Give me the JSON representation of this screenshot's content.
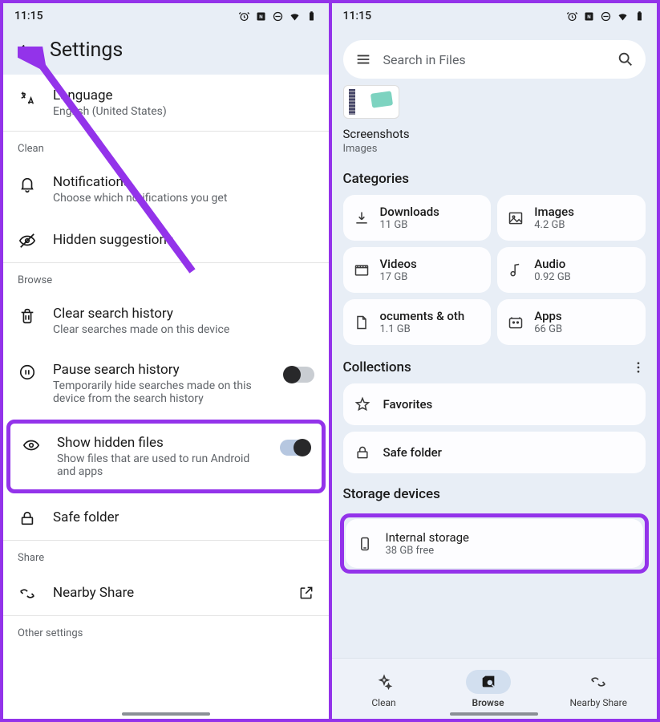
{
  "status": {
    "time": "11:15"
  },
  "left": {
    "header_title": "Settings",
    "language": {
      "title": "Language",
      "sub": "English (United States)"
    },
    "section_clean": "Clean",
    "notifications": {
      "title": "Notifications",
      "sub": "Choose which notifications you get"
    },
    "hidden_suggestions": {
      "title": "Hidden suggestions"
    },
    "section_browse": "Browse",
    "clear_history": {
      "title": "Clear search history",
      "sub": "Clear searches made on this device"
    },
    "pause_history": {
      "title": "Pause search history",
      "sub": "Temporarily hide searches made on this device from the search history"
    },
    "show_hidden": {
      "title": "Show hidden files",
      "sub": "Show files that are used to run Android and apps"
    },
    "safe_folder": {
      "title": "Safe folder"
    },
    "section_share": "Share",
    "nearby_share": {
      "title": "Nearby Share"
    },
    "section_other": "Other settings"
  },
  "right": {
    "search_placeholder": "Search in Files",
    "recent_title": "Screenshots",
    "recent_sub": "Images",
    "categories_heading": "Categories",
    "categories": [
      {
        "title": "Downloads",
        "sub": "11 GB"
      },
      {
        "title": "Images",
        "sub": "4.2 GB"
      },
      {
        "title": "Videos",
        "sub": "17 GB"
      },
      {
        "title": "Audio",
        "sub": "0.92 GB"
      },
      {
        "title": "ocuments & oth",
        "sub": "1.1 GB"
      },
      {
        "title": "Apps",
        "sub": "66 GB"
      }
    ],
    "collections_heading": "Collections",
    "favorites": "Favorites",
    "safe_folder": "Safe folder",
    "storage_heading": "Storage devices",
    "storage": {
      "title": "Internal storage",
      "sub": "38 GB free"
    },
    "nav": {
      "clean": "Clean",
      "browse": "Browse",
      "share": "Nearby Share"
    }
  }
}
